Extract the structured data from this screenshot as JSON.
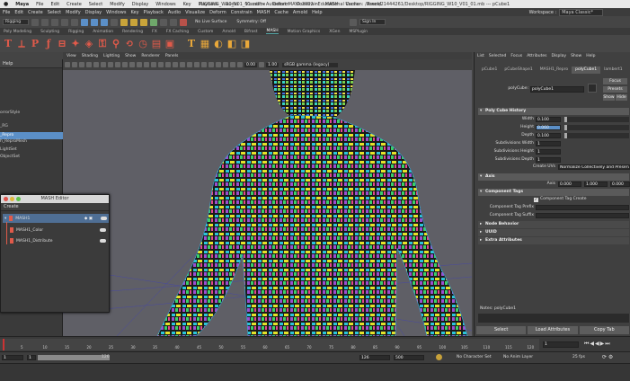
{
  "macbar": {
    "apple": "",
    "items": [
      "Maya",
      "File",
      "Edit",
      "Create",
      "Select",
      "Modify",
      "Display",
      "Windows",
      "Key",
      "Playback",
      "Audio",
      "Visualize",
      "Deform",
      "Constrain",
      "MASH",
      "Cache",
      "Arnold",
      "Help"
    ],
    "window_title": "RIGGING_W10_V01_01.mb* - Autodesk MAYA 2022 - Educational Version: /Users/21444261/Desktop/RIGGING_W10_V01_01.mb  ---  pCube1"
  },
  "status": {
    "mode": "Rigging",
    "live_surface": "No Live Surface",
    "symmetry": "Symmetry: Off",
    "sign_in": "Sign In",
    "workspace_label": "Workspace :",
    "workspace_value": "Maya Classic*"
  },
  "shelf_tabs": [
    "Poly Modeling",
    "Sculpting",
    "Rigging",
    "Animation",
    "Rendering",
    "FX",
    "FX Caching",
    "Custom",
    "Arnold",
    "Bifrost",
    "MASH",
    "Motion Graphics",
    "XGen",
    "MSPlugin"
  ],
  "shelf_active": "MASH",
  "outliner": {
    "help": "Help",
    "rows": [
      "orrorStyle",
      "",
      "_RG",
      "_Repro",
      "",
      "h_ReproMesh",
      "LightSet",
      "ObjectSet"
    ]
  },
  "viewport": {
    "menus": [
      "View",
      "Shading",
      "Lighting",
      "Show",
      "Renderer",
      "Panels"
    ],
    "value_a": "0.00",
    "value_b": "1.00",
    "color_space": "sRGB gamma (legacy)"
  },
  "mash_editor": {
    "title": "MASH Editor",
    "create": "Create",
    "network": "MASH1",
    "nodes": [
      "MASH1_Color",
      "MASH1_Distribute"
    ]
  },
  "attribute_editor": {
    "menu": [
      "List",
      "Selected",
      "Focus",
      "Attributes",
      "Display",
      "Show",
      "Help"
    ],
    "tabs": [
      "pCube1",
      "pCubeShape1",
      "MASH1_Repro",
      "polyCube1",
      "lambert1"
    ],
    "active_tab": "polyCube1",
    "node_label": "polyCube:",
    "node_value": "polyCube1",
    "focus": "Focus",
    "presets": "Presets",
    "show": "Show",
    "hide": "Hide",
    "history_section": "Poly Cube History",
    "fields": [
      {
        "label": "Width",
        "value": "0.100"
      },
      {
        "label": "Height",
        "value": "0.060"
      },
      {
        "label": "Depth",
        "value": "0.100"
      },
      {
        "label": "Subdivisions Width",
        "value": "1"
      },
      {
        "label": "Subdivisions Height",
        "value": "1"
      },
      {
        "label": "Subdivisions Depth",
        "value": "1"
      }
    ],
    "create_uvs_label": "Create UVs",
    "create_uvs_value": "Normalize Collectively and Preserve Aspect Ratio",
    "axis_section": "Axis",
    "axis_label": "Axis",
    "axis_values": [
      "0.000",
      "1.000",
      "0.000"
    ],
    "tags_section": "Component Tags",
    "tag_create": "Component Tag Create",
    "tag_prefix": "Component Tag Prefix",
    "tag_suffix": "Component Tag Suffix",
    "closed_sections": [
      "Node Behavior",
      "UUID",
      "Extra Attributes"
    ],
    "notes": "Notes:  polyCube1",
    "bottom_buttons": [
      "Select",
      "Load Attributes",
      "Copy Tab"
    ]
  },
  "timeline": {
    "ticks": [
      "5",
      "10",
      "15",
      "20",
      "25",
      "30",
      "35",
      "40",
      "45",
      "50",
      "55",
      "60",
      "65",
      "70",
      "75",
      "80",
      "85",
      "90",
      "95",
      "100",
      "105",
      "110",
      "115",
      "120"
    ],
    "current_frame": "1"
  },
  "range": {
    "start": "1",
    "inner_start": "1",
    "inner_end": "126",
    "end": "126",
    "max": "500",
    "character_set": "No Character Set",
    "anim_layer": "No Anim Layer",
    "fps": "25 fps"
  },
  "colors": {
    "accent": "#5b8fc7",
    "mash_tab": "#5aa"
  }
}
